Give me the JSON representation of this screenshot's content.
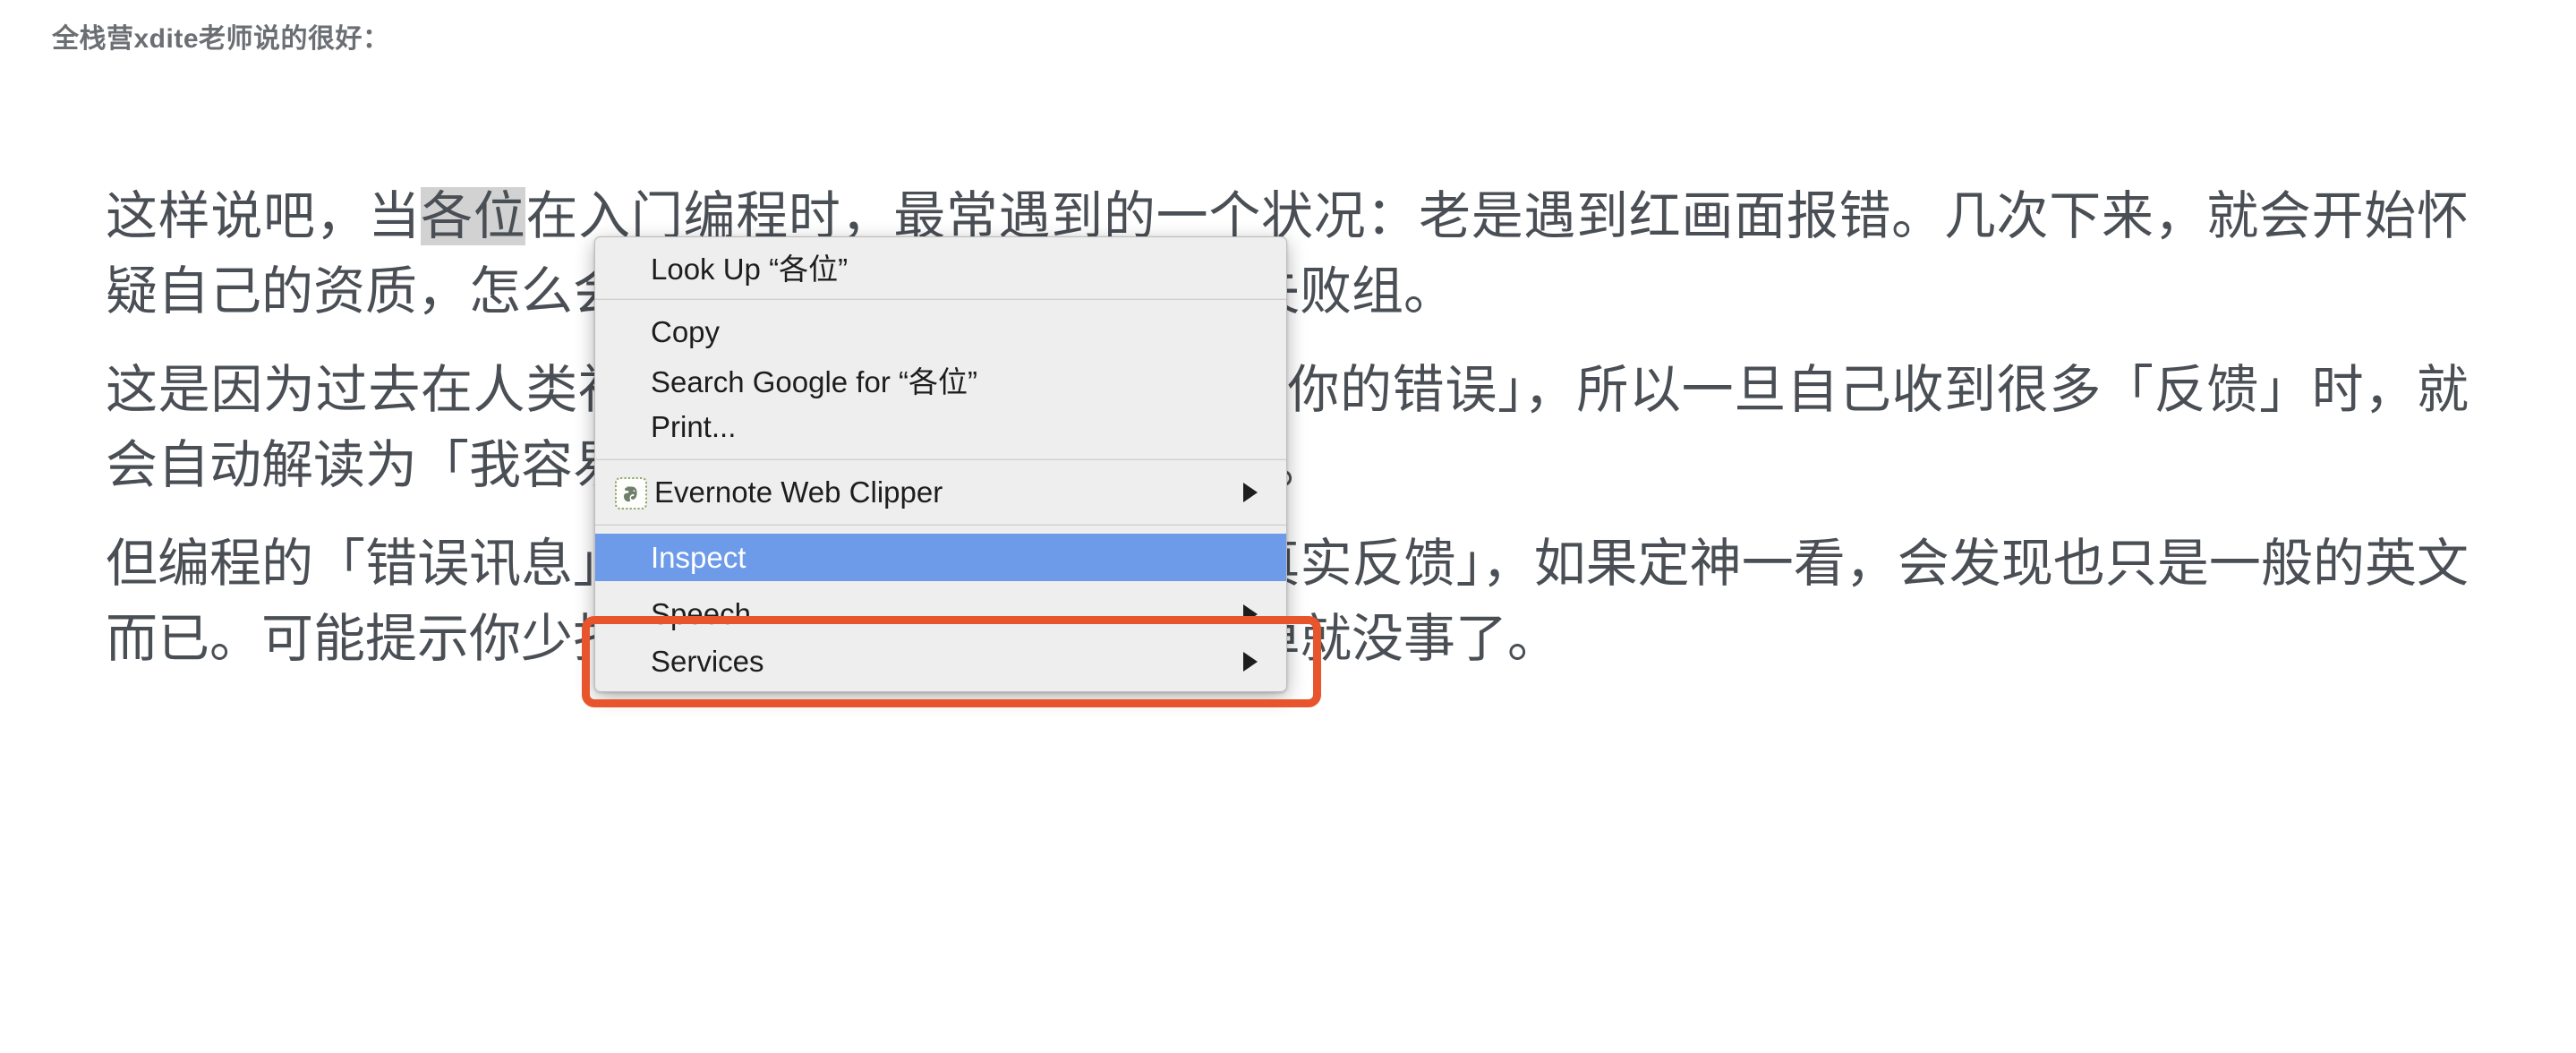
{
  "page": {
    "heading": "全栈营xdite老师说的很好：",
    "selected_text": "各位",
    "paragraphs": [
      {
        "id": "p1",
        "before_selection": "这样说吧，当",
        "selection": "各位",
        "after_selection": "在入门编程时，最常遇到的一个状况：老是遇到红画面报错。几次下来，就会开始怀疑自己的资质，怎么会这么容易出错，是不是人生失败组。"
      },
      {
        "id": "p2",
        "text": "这是因为过去在人类社会里，「很少有人会当面指出你的错误」，所以一旦自己收到很多「反馈」时，就会自动解读为「我容易犯错」，容易陷入深深的挫败。"
      },
      {
        "id": "p3",
        "text": "但编程的「错误讯息」其实只是机器「不懂」的「真实反馈」，如果定神一看，会发现也只是一般的英文而已。可能提示你少打几个字，或拼错字而已。改掉就没事了。"
      }
    ]
  },
  "context_menu": {
    "groups": [
      {
        "items": [
          {
            "label": "Look Up “各位”",
            "icon": null,
            "submenu": false,
            "highlighted": false
          }
        ]
      },
      {
        "items": [
          {
            "label": "Copy",
            "icon": null,
            "submenu": false,
            "highlighted": false
          },
          {
            "label": "Search Google for “各位”",
            "icon": null,
            "submenu": false,
            "highlighted": false
          },
          {
            "label": "Print...",
            "icon": null,
            "submenu": false,
            "highlighted": false
          }
        ]
      },
      {
        "items": [
          {
            "label": "Evernote Web Clipper",
            "icon": "evernote-elephant-icon",
            "submenu": true,
            "highlighted": false
          }
        ]
      },
      {
        "items": [
          {
            "label": "Inspect",
            "icon": null,
            "submenu": false,
            "highlighted": true
          }
        ]
      },
      {
        "items": [
          {
            "label": "Speech",
            "icon": null,
            "submenu": true,
            "highlighted": false
          },
          {
            "label": "Services",
            "icon": null,
            "submenu": true,
            "highlighted": false
          }
        ]
      }
    ]
  },
  "annotation": {
    "target_label": "Inspect",
    "shape": "rounded-rectangle",
    "color": "#e8552d"
  },
  "colors": {
    "menu_background": "#eeeeee",
    "menu_border": "#bdbdbd",
    "highlight_blue": "#6d9bea",
    "highlight_text": "#ffffff",
    "annotation_red": "#e8552d",
    "text_selection_gray": "#d2d2d2",
    "heading_gray": "#6b6f73",
    "body_text": "#4a4f55",
    "page_background": "#ffffff"
  }
}
